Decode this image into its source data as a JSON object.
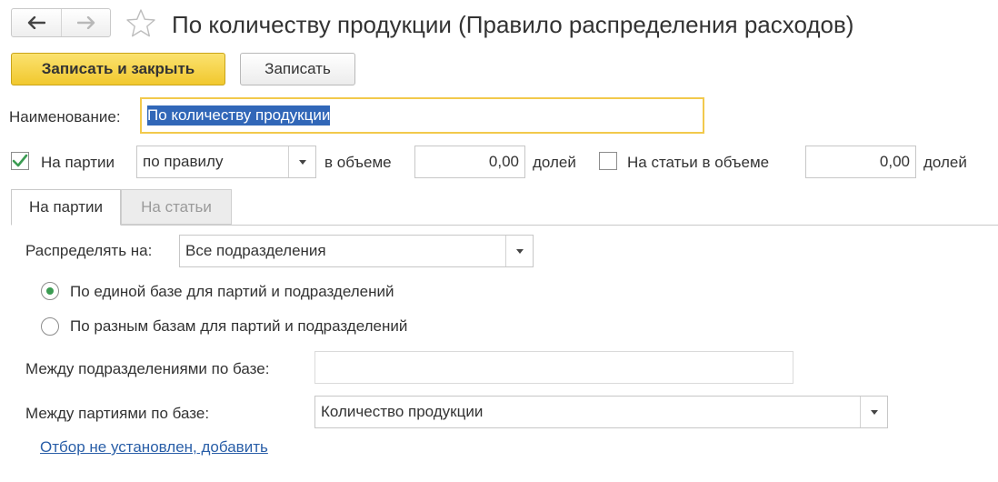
{
  "header": {
    "title": "По количеству продукции (Правило распределения расходов)",
    "back_icon": "arrow-left-icon",
    "forward_icon": "arrow-right-icon",
    "favorite_icon": "star-icon"
  },
  "toolbar": {
    "save_close_label": "Записать и закрыть",
    "save_label": "Записать"
  },
  "form": {
    "name_label": "Наименование:",
    "name_value": "По количеству продукции",
    "batches_checkbox_label": "На партии",
    "batches_checked": true,
    "batches_rule_value": "по правилу",
    "in_volume_label": "в объеме",
    "batches_volume_value": "0,00",
    "shares_label": "долей",
    "items_checkbox_label": "На статьи в объеме",
    "items_checked": false,
    "items_volume_value": "0,00",
    "items_shares_label": "долей"
  },
  "tabs": [
    {
      "label": "На партии",
      "active": true
    },
    {
      "label": "На статьи",
      "active": false
    }
  ],
  "tab_content": {
    "distribute_label": "Распределять на:",
    "distribute_value": "Все подразделения",
    "radio_options": [
      {
        "label": "По единой базе для партий и подразделений",
        "selected": true
      },
      {
        "label": "По разным базам для партий и подразделений",
        "selected": false
      }
    ],
    "between_departments_label": "Между подразделениями по базе:",
    "between_departments_value": "",
    "between_batches_label": "Между партиями по базе:",
    "between_batches_value": "Количество продукции",
    "filter_link": "Отбор не установлен, добавить"
  },
  "colors": {
    "accent_yellow": "#f2c94c",
    "selection_blue": "#3167b8",
    "link_blue": "#2a5fa8",
    "check_green": "#3b9b52"
  }
}
